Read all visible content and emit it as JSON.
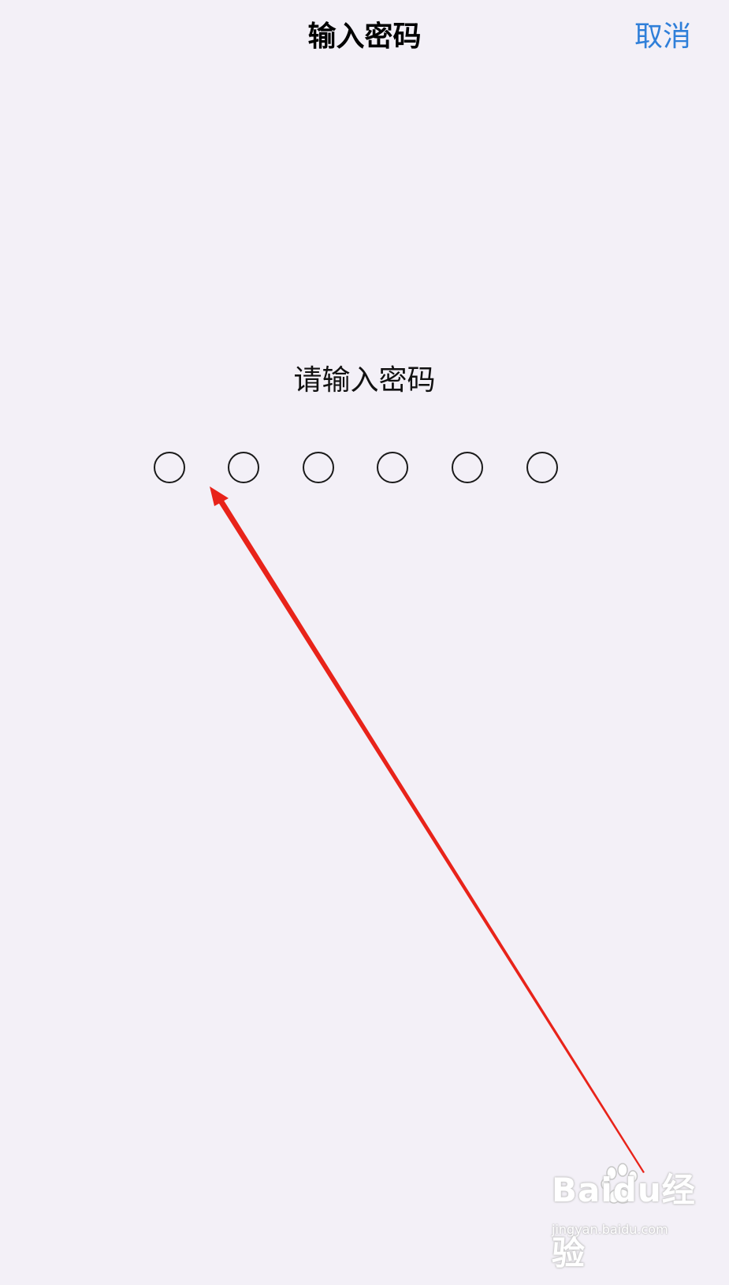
{
  "nav": {
    "title": "输入密码",
    "cancel_label": "取消"
  },
  "prompt": {
    "text": "请输入密码"
  },
  "pin": {
    "length": 6,
    "filled": 0
  },
  "colors": {
    "background": "#f3f0f7",
    "accent": "#2f7fd9",
    "annotation_arrow": "#e8231a"
  },
  "watermark": {
    "brand": "Baidu经验",
    "url": "jingyan.baidu.com"
  }
}
